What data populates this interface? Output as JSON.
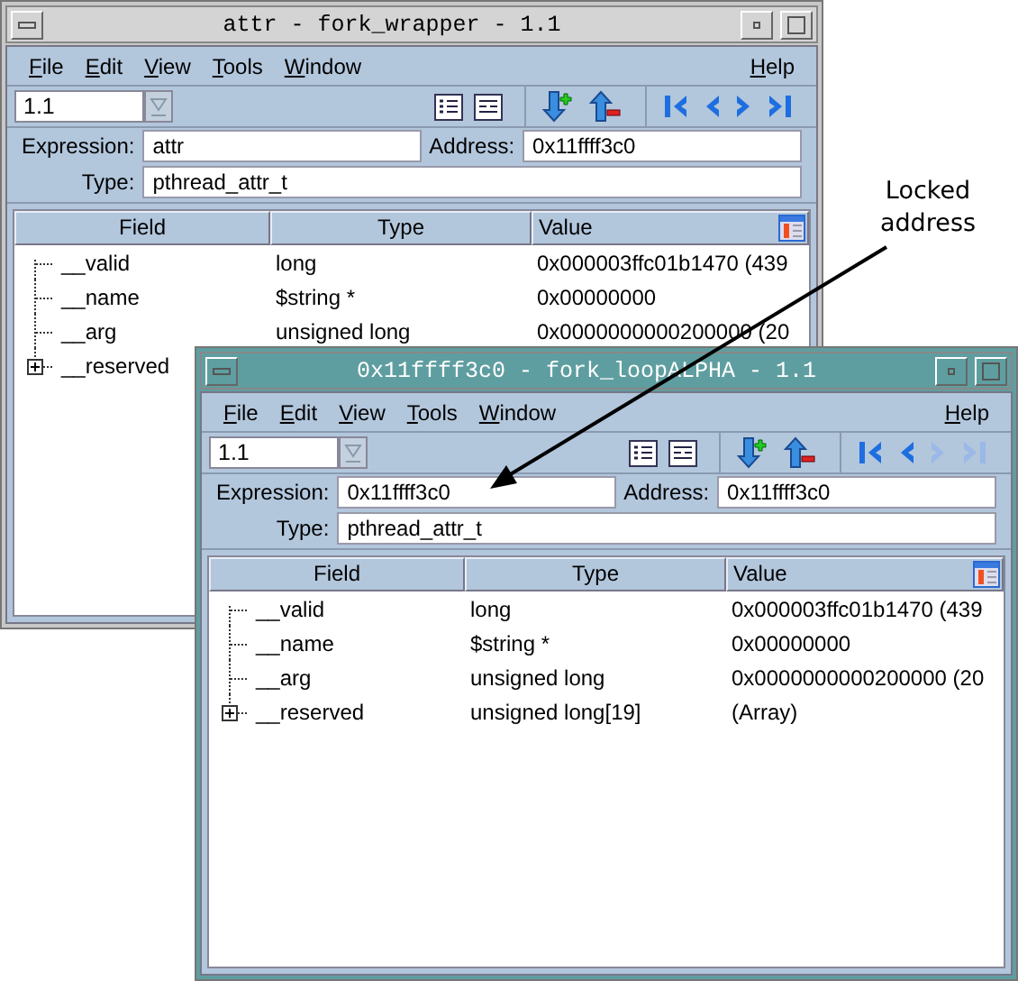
{
  "windows": [
    {
      "title": "attr - fork_wrapper - 1.1",
      "active": false,
      "menus": [
        "File",
        "Edit",
        "View",
        "Tools",
        "Window"
      ],
      "help_menu": "Help",
      "thread_combo": {
        "value": "1.1"
      },
      "nav_buttons": [
        {
          "kind": "first",
          "disabled": false
        },
        {
          "kind": "prev",
          "disabled": false
        },
        {
          "kind": "next",
          "disabled": false
        },
        {
          "kind": "last",
          "disabled": false
        }
      ],
      "expression": {
        "label": "Expression:",
        "value": "attr"
      },
      "address": {
        "label": "Address:",
        "value": "0x11ffff3c0"
      },
      "type": {
        "label": "Type:",
        "value": "pthread_attr_t"
      },
      "table": {
        "columns": [
          "Field",
          "Type",
          "Value"
        ],
        "rows": [
          {
            "field": "__valid",
            "type": "long",
            "value": "0x000003ffc01b1470 (439",
            "expandable": false
          },
          {
            "field": "__name",
            "type": "$string *",
            "value": "0x00000000",
            "expandable": false
          },
          {
            "field": "__arg",
            "type": "unsigned long",
            "value": "0x0000000000200000 (20",
            "expandable": false
          },
          {
            "field": "__reserved",
            "expandable": true,
            "expanded": false
          }
        ]
      }
    },
    {
      "title": "0x11ffff3c0 - fork_loopALPHA - 1.1",
      "active": true,
      "menus": [
        "File",
        "Edit",
        "View",
        "Tools",
        "Window"
      ],
      "help_menu": "Help",
      "thread_combo": {
        "value": "1.1"
      },
      "nav_buttons": [
        {
          "kind": "first",
          "disabled": false
        },
        {
          "kind": "prev",
          "disabled": false
        },
        {
          "kind": "next",
          "disabled": true
        },
        {
          "kind": "last",
          "disabled": true
        }
      ],
      "expression": {
        "label": "Expression:",
        "value": "0x11ffff3c0"
      },
      "address": {
        "label": "Address:",
        "value": "0x11ffff3c0"
      },
      "type": {
        "label": "Type:",
        "value": "pthread_attr_t"
      },
      "table": {
        "columns": [
          "Field",
          "Type",
          "Value"
        ],
        "rows": [
          {
            "field": "__valid",
            "type": "long",
            "value": "0x000003ffc01b1470 (439",
            "expandable": false
          },
          {
            "field": "__name",
            "type": "$string *",
            "value": "0x00000000",
            "expandable": false
          },
          {
            "field": "__arg",
            "type": "unsigned long",
            "value": "0x0000000000200000 (20",
            "expandable": false
          },
          {
            "field": "__reserved",
            "type": "unsigned long[19]",
            "value": "(Array)",
            "expandable": true,
            "expanded": false
          }
        ]
      }
    }
  ],
  "annotation": {
    "text": "Locked address"
  }
}
